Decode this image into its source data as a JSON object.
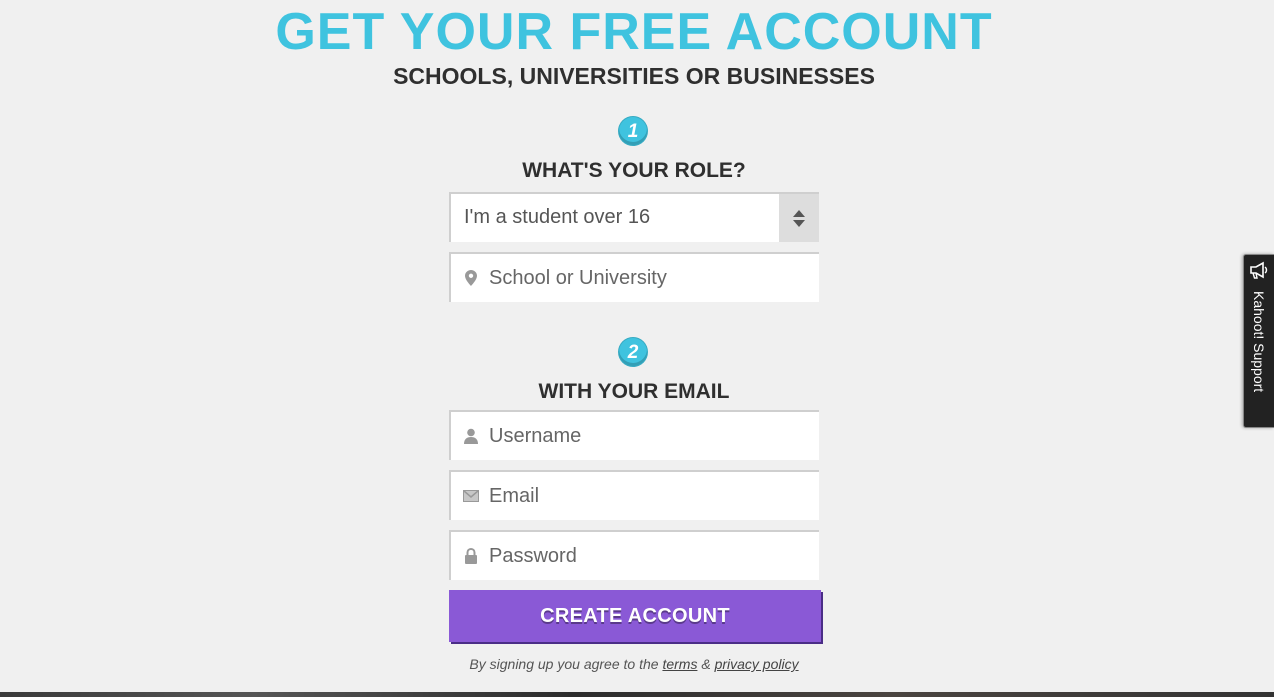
{
  "colors": {
    "accent": "#3fc3df",
    "button": "#8a59d6",
    "page_background": "#f0f0f0"
  },
  "header": {
    "title": "GET YOUR FREE ACCOUNT",
    "subtitle": "SCHOOLS, UNIVERSITIES OR BUSINESSES"
  },
  "step1": {
    "number": "1",
    "title": "WHAT'S YOUR ROLE?",
    "role_select": {
      "selected_value": "I'm a student over 16"
    },
    "school_field": {
      "icon": "map-pin-icon",
      "placeholder": "School or University",
      "value": ""
    }
  },
  "step2": {
    "number": "2",
    "title": "WITH YOUR EMAIL",
    "username_field": {
      "icon": "user-icon",
      "placeholder": "Username",
      "value": ""
    },
    "email_field": {
      "icon": "envelope-icon",
      "placeholder": "Email",
      "value": ""
    },
    "password_field": {
      "icon": "lock-icon",
      "placeholder": "Password",
      "value": ""
    }
  },
  "create_button_label": "CREATE ACCOUNT",
  "terms": {
    "prefix": "By signing up you agree to the",
    "terms_link": "terms",
    "ampersand": "&",
    "privacy_link": "privacy policy"
  },
  "support_tab": {
    "label": "Kahoot! Support",
    "icon": "megaphone-icon"
  }
}
